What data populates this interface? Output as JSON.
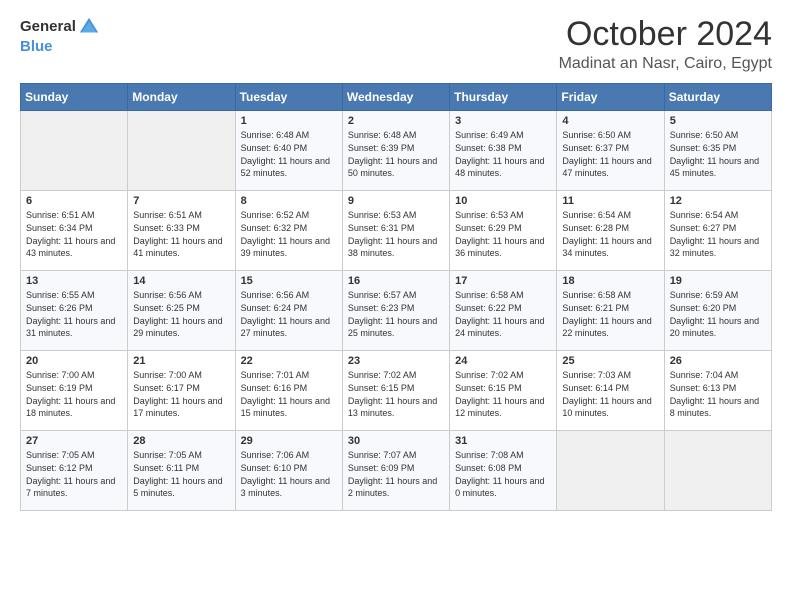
{
  "header": {
    "logo_general": "General",
    "logo_blue": "Blue",
    "month": "October 2024",
    "location": "Madinat an Nasr, Cairo, Egypt"
  },
  "days_of_week": [
    "Sunday",
    "Monday",
    "Tuesday",
    "Wednesday",
    "Thursday",
    "Friday",
    "Saturday"
  ],
  "weeks": [
    [
      {
        "day": "",
        "content": ""
      },
      {
        "day": "",
        "content": ""
      },
      {
        "day": "1",
        "content": "Sunrise: 6:48 AM\nSunset: 6:40 PM\nDaylight: 11 hours and 52 minutes."
      },
      {
        "day": "2",
        "content": "Sunrise: 6:48 AM\nSunset: 6:39 PM\nDaylight: 11 hours and 50 minutes."
      },
      {
        "day": "3",
        "content": "Sunrise: 6:49 AM\nSunset: 6:38 PM\nDaylight: 11 hours and 48 minutes."
      },
      {
        "day": "4",
        "content": "Sunrise: 6:50 AM\nSunset: 6:37 PM\nDaylight: 11 hours and 47 minutes."
      },
      {
        "day": "5",
        "content": "Sunrise: 6:50 AM\nSunset: 6:35 PM\nDaylight: 11 hours and 45 minutes."
      }
    ],
    [
      {
        "day": "6",
        "content": "Sunrise: 6:51 AM\nSunset: 6:34 PM\nDaylight: 11 hours and 43 minutes."
      },
      {
        "day": "7",
        "content": "Sunrise: 6:51 AM\nSunset: 6:33 PM\nDaylight: 11 hours and 41 minutes."
      },
      {
        "day": "8",
        "content": "Sunrise: 6:52 AM\nSunset: 6:32 PM\nDaylight: 11 hours and 39 minutes."
      },
      {
        "day": "9",
        "content": "Sunrise: 6:53 AM\nSunset: 6:31 PM\nDaylight: 11 hours and 38 minutes."
      },
      {
        "day": "10",
        "content": "Sunrise: 6:53 AM\nSunset: 6:29 PM\nDaylight: 11 hours and 36 minutes."
      },
      {
        "day": "11",
        "content": "Sunrise: 6:54 AM\nSunset: 6:28 PM\nDaylight: 11 hours and 34 minutes."
      },
      {
        "day": "12",
        "content": "Sunrise: 6:54 AM\nSunset: 6:27 PM\nDaylight: 11 hours and 32 minutes."
      }
    ],
    [
      {
        "day": "13",
        "content": "Sunrise: 6:55 AM\nSunset: 6:26 PM\nDaylight: 11 hours and 31 minutes."
      },
      {
        "day": "14",
        "content": "Sunrise: 6:56 AM\nSunset: 6:25 PM\nDaylight: 11 hours and 29 minutes."
      },
      {
        "day": "15",
        "content": "Sunrise: 6:56 AM\nSunset: 6:24 PM\nDaylight: 11 hours and 27 minutes."
      },
      {
        "day": "16",
        "content": "Sunrise: 6:57 AM\nSunset: 6:23 PM\nDaylight: 11 hours and 25 minutes."
      },
      {
        "day": "17",
        "content": "Sunrise: 6:58 AM\nSunset: 6:22 PM\nDaylight: 11 hours and 24 minutes."
      },
      {
        "day": "18",
        "content": "Sunrise: 6:58 AM\nSunset: 6:21 PM\nDaylight: 11 hours and 22 minutes."
      },
      {
        "day": "19",
        "content": "Sunrise: 6:59 AM\nSunset: 6:20 PM\nDaylight: 11 hours and 20 minutes."
      }
    ],
    [
      {
        "day": "20",
        "content": "Sunrise: 7:00 AM\nSunset: 6:19 PM\nDaylight: 11 hours and 18 minutes."
      },
      {
        "day": "21",
        "content": "Sunrise: 7:00 AM\nSunset: 6:17 PM\nDaylight: 11 hours and 17 minutes."
      },
      {
        "day": "22",
        "content": "Sunrise: 7:01 AM\nSunset: 6:16 PM\nDaylight: 11 hours and 15 minutes."
      },
      {
        "day": "23",
        "content": "Sunrise: 7:02 AM\nSunset: 6:15 PM\nDaylight: 11 hours and 13 minutes."
      },
      {
        "day": "24",
        "content": "Sunrise: 7:02 AM\nSunset: 6:15 PM\nDaylight: 11 hours and 12 minutes."
      },
      {
        "day": "25",
        "content": "Sunrise: 7:03 AM\nSunset: 6:14 PM\nDaylight: 11 hours and 10 minutes."
      },
      {
        "day": "26",
        "content": "Sunrise: 7:04 AM\nSunset: 6:13 PM\nDaylight: 11 hours and 8 minutes."
      }
    ],
    [
      {
        "day": "27",
        "content": "Sunrise: 7:05 AM\nSunset: 6:12 PM\nDaylight: 11 hours and 7 minutes."
      },
      {
        "day": "28",
        "content": "Sunrise: 7:05 AM\nSunset: 6:11 PM\nDaylight: 11 hours and 5 minutes."
      },
      {
        "day": "29",
        "content": "Sunrise: 7:06 AM\nSunset: 6:10 PM\nDaylight: 11 hours and 3 minutes."
      },
      {
        "day": "30",
        "content": "Sunrise: 7:07 AM\nSunset: 6:09 PM\nDaylight: 11 hours and 2 minutes."
      },
      {
        "day": "31",
        "content": "Sunrise: 7:08 AM\nSunset: 6:08 PM\nDaylight: 11 hours and 0 minutes."
      },
      {
        "day": "",
        "content": ""
      },
      {
        "day": "",
        "content": ""
      }
    ]
  ]
}
